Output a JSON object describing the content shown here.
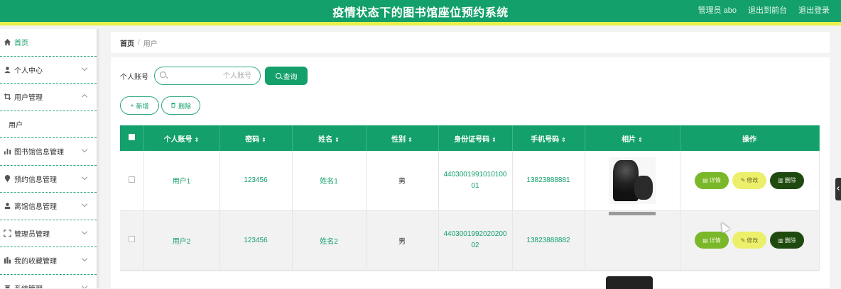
{
  "header": {
    "title": "疫情状态下的图书馆座位预约系统",
    "admin_label": "管理员 abo",
    "back_label": "退出到前台",
    "logout_label": "退出登录"
  },
  "sidebar": {
    "items": [
      {
        "label": "首页",
        "icon": "home-icon"
      },
      {
        "label": "个人中心",
        "icon": "user-icon"
      },
      {
        "label": "用户管理",
        "icon": "crop-icon"
      },
      {
        "label": "用户",
        "icon": ""
      },
      {
        "label": "图书馆信息管理",
        "icon": "bar-chart-icon"
      },
      {
        "label": "预约信息管理",
        "icon": "location-icon"
      },
      {
        "label": "离馆信息管理",
        "icon": "person-icon"
      },
      {
        "label": "管理员管理",
        "icon": "frame-icon"
      },
      {
        "label": "我的收藏管理",
        "icon": "chart-icon"
      },
      {
        "label": "系统管理",
        "icon": "trash-icon"
      }
    ]
  },
  "breadcrumb": {
    "home": "首页",
    "sep": "/",
    "current": "用户"
  },
  "search": {
    "label": "个人账号",
    "placeholder": "个人账号",
    "value": "",
    "button": "查询"
  },
  "actions": {
    "add": "新增",
    "delete": "删除"
  },
  "table": {
    "headers": [
      "个人账号",
      "密码",
      "姓名",
      "性别",
      "身份证号码",
      "手机号码",
      "相片",
      "操作"
    ],
    "rows": [
      {
        "account": "用户1",
        "password": "123456",
        "name": "姓名1",
        "gender": "男",
        "id_line1": "4403001991010100",
        "id_line2": "01",
        "phone": "13823888881"
      },
      {
        "account": "用户2",
        "password": "123456",
        "name": "姓名2",
        "gender": "男",
        "id_line1": "4403001992020200",
        "id_line2": "02",
        "phone": "13823888882"
      }
    ],
    "ops": {
      "detail": "详情",
      "edit": "修改",
      "del": "删除"
    }
  },
  "colors": {
    "primary": "#13a06a",
    "accent_bar": "#e6f04a",
    "detail": "#7ab82a",
    "edit": "#ecef6a",
    "delete": "#1f4a0f"
  }
}
